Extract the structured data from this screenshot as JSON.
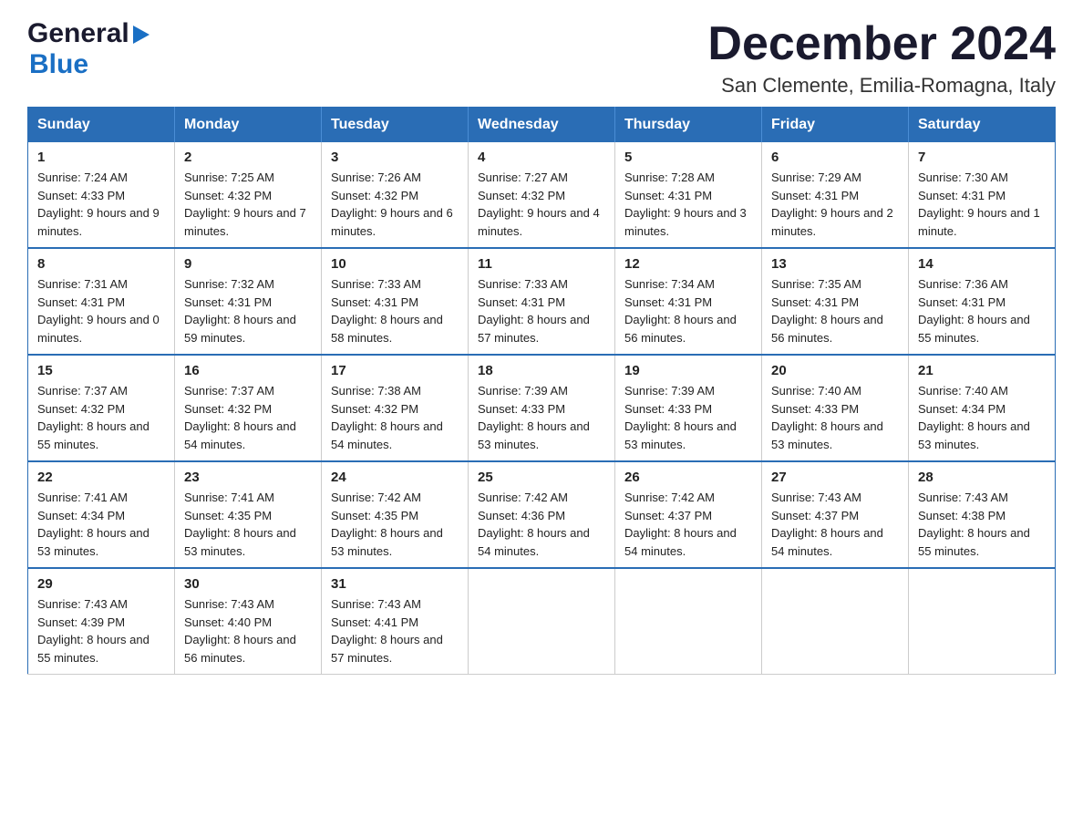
{
  "logo": {
    "general": "General",
    "blue": "Blue"
  },
  "title": "December 2024",
  "subtitle": "San Clemente, Emilia-Romagna, Italy",
  "days_of_week": [
    "Sunday",
    "Monday",
    "Tuesday",
    "Wednesday",
    "Thursday",
    "Friday",
    "Saturday"
  ],
  "weeks": [
    [
      {
        "day": "1",
        "sunrise": "7:24 AM",
        "sunset": "4:33 PM",
        "daylight": "9 hours and 9 minutes."
      },
      {
        "day": "2",
        "sunrise": "7:25 AM",
        "sunset": "4:32 PM",
        "daylight": "9 hours and 7 minutes."
      },
      {
        "day": "3",
        "sunrise": "7:26 AM",
        "sunset": "4:32 PM",
        "daylight": "9 hours and 6 minutes."
      },
      {
        "day": "4",
        "sunrise": "7:27 AM",
        "sunset": "4:32 PM",
        "daylight": "9 hours and 4 minutes."
      },
      {
        "day": "5",
        "sunrise": "7:28 AM",
        "sunset": "4:31 PM",
        "daylight": "9 hours and 3 minutes."
      },
      {
        "day": "6",
        "sunrise": "7:29 AM",
        "sunset": "4:31 PM",
        "daylight": "9 hours and 2 minutes."
      },
      {
        "day": "7",
        "sunrise": "7:30 AM",
        "sunset": "4:31 PM",
        "daylight": "9 hours and 1 minute."
      }
    ],
    [
      {
        "day": "8",
        "sunrise": "7:31 AM",
        "sunset": "4:31 PM",
        "daylight": "9 hours and 0 minutes."
      },
      {
        "day": "9",
        "sunrise": "7:32 AM",
        "sunset": "4:31 PM",
        "daylight": "8 hours and 59 minutes."
      },
      {
        "day": "10",
        "sunrise": "7:33 AM",
        "sunset": "4:31 PM",
        "daylight": "8 hours and 58 minutes."
      },
      {
        "day": "11",
        "sunrise": "7:33 AM",
        "sunset": "4:31 PM",
        "daylight": "8 hours and 57 minutes."
      },
      {
        "day": "12",
        "sunrise": "7:34 AM",
        "sunset": "4:31 PM",
        "daylight": "8 hours and 56 minutes."
      },
      {
        "day": "13",
        "sunrise": "7:35 AM",
        "sunset": "4:31 PM",
        "daylight": "8 hours and 56 minutes."
      },
      {
        "day": "14",
        "sunrise": "7:36 AM",
        "sunset": "4:31 PM",
        "daylight": "8 hours and 55 minutes."
      }
    ],
    [
      {
        "day": "15",
        "sunrise": "7:37 AM",
        "sunset": "4:32 PM",
        "daylight": "8 hours and 55 minutes."
      },
      {
        "day": "16",
        "sunrise": "7:37 AM",
        "sunset": "4:32 PM",
        "daylight": "8 hours and 54 minutes."
      },
      {
        "day": "17",
        "sunrise": "7:38 AM",
        "sunset": "4:32 PM",
        "daylight": "8 hours and 54 minutes."
      },
      {
        "day": "18",
        "sunrise": "7:39 AM",
        "sunset": "4:33 PM",
        "daylight": "8 hours and 53 minutes."
      },
      {
        "day": "19",
        "sunrise": "7:39 AM",
        "sunset": "4:33 PM",
        "daylight": "8 hours and 53 minutes."
      },
      {
        "day": "20",
        "sunrise": "7:40 AM",
        "sunset": "4:33 PM",
        "daylight": "8 hours and 53 minutes."
      },
      {
        "day": "21",
        "sunrise": "7:40 AM",
        "sunset": "4:34 PM",
        "daylight": "8 hours and 53 minutes."
      }
    ],
    [
      {
        "day": "22",
        "sunrise": "7:41 AM",
        "sunset": "4:34 PM",
        "daylight": "8 hours and 53 minutes."
      },
      {
        "day": "23",
        "sunrise": "7:41 AM",
        "sunset": "4:35 PM",
        "daylight": "8 hours and 53 minutes."
      },
      {
        "day": "24",
        "sunrise": "7:42 AM",
        "sunset": "4:35 PM",
        "daylight": "8 hours and 53 minutes."
      },
      {
        "day": "25",
        "sunrise": "7:42 AM",
        "sunset": "4:36 PM",
        "daylight": "8 hours and 54 minutes."
      },
      {
        "day": "26",
        "sunrise": "7:42 AM",
        "sunset": "4:37 PM",
        "daylight": "8 hours and 54 minutes."
      },
      {
        "day": "27",
        "sunrise": "7:43 AM",
        "sunset": "4:37 PM",
        "daylight": "8 hours and 54 minutes."
      },
      {
        "day": "28",
        "sunrise": "7:43 AM",
        "sunset": "4:38 PM",
        "daylight": "8 hours and 55 minutes."
      }
    ],
    [
      {
        "day": "29",
        "sunrise": "7:43 AM",
        "sunset": "4:39 PM",
        "daylight": "8 hours and 55 minutes."
      },
      {
        "day": "30",
        "sunrise": "7:43 AM",
        "sunset": "4:40 PM",
        "daylight": "8 hours and 56 minutes."
      },
      {
        "day": "31",
        "sunrise": "7:43 AM",
        "sunset": "4:41 PM",
        "daylight": "8 hours and 57 minutes."
      },
      null,
      null,
      null,
      null
    ]
  ]
}
